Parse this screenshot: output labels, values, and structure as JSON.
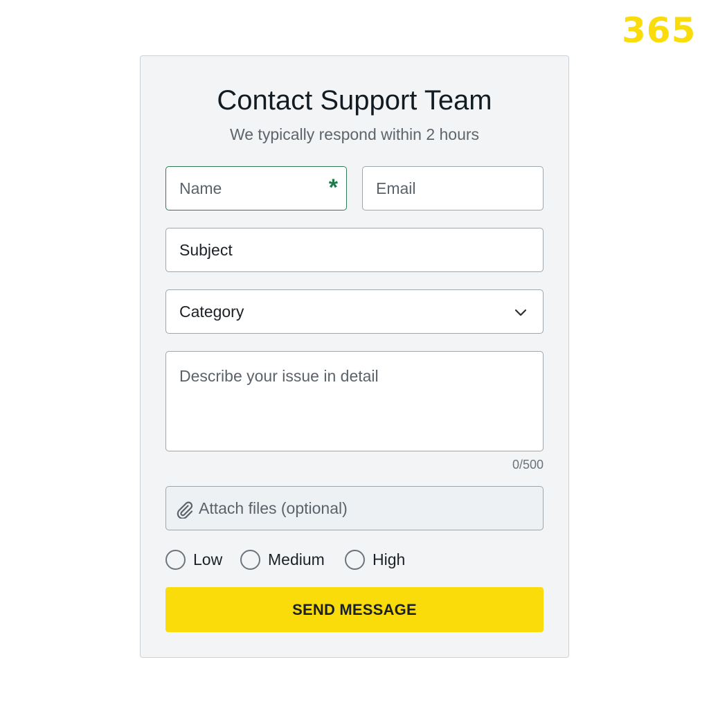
{
  "brand": {
    "logo_text": "365",
    "color": "#f9dc0a"
  },
  "form": {
    "title": "Contact Support Team",
    "subtitle": "We typically respond within 2 hours",
    "name_placeholder": "Name",
    "name_required_mark": "*",
    "email_placeholder": "Email",
    "subject_label": "Subject",
    "category_label": "Category",
    "description_placeholder": "Describe your issue in detail",
    "char_count": "0/500",
    "attach_label": "Attach files (optional)",
    "priority_options": [
      {
        "label": "Low",
        "selected": false
      },
      {
        "label": "Medium",
        "selected": false
      },
      {
        "label": "High",
        "selected": false
      }
    ],
    "submit_label": "SEND MESSAGE"
  },
  "colors": {
    "accent": "#f9dc0a",
    "required": "#1c7a4c",
    "card_background": "#f2f4f6"
  },
  "icons": {
    "category_dropdown": "chevron-down-icon",
    "attach": "paperclip-icon"
  }
}
